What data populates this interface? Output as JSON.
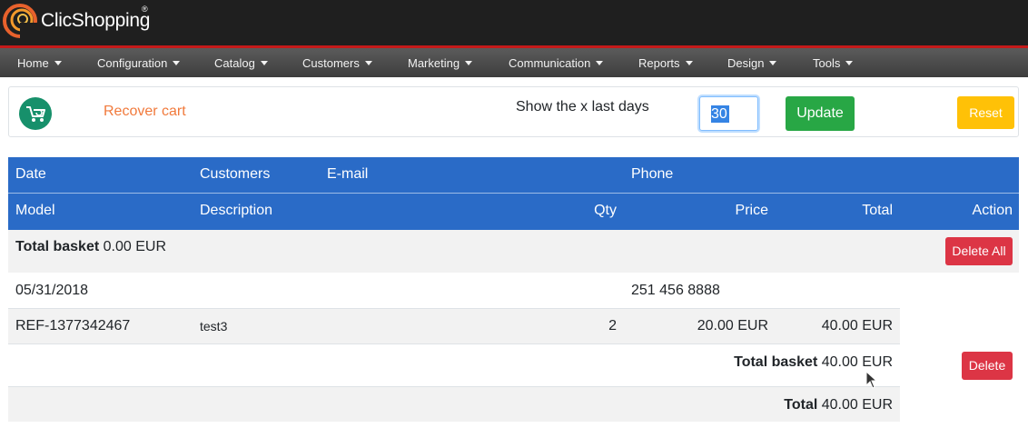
{
  "app": {
    "brand": "ClicShopping",
    "brand_mark": "®"
  },
  "nav": {
    "items": [
      {
        "label": "Home"
      },
      {
        "label": "Configuration"
      },
      {
        "label": "Catalog"
      },
      {
        "label": "Customers"
      },
      {
        "label": "Marketing"
      },
      {
        "label": "Communication"
      },
      {
        "label": "Reports"
      },
      {
        "label": "Design"
      },
      {
        "label": "Tools"
      }
    ]
  },
  "toolbar": {
    "icon": "shopping-cart-refresh-icon",
    "heading": "Recover cart",
    "days_label": "Show the x last days",
    "days_value": "30",
    "update_label": "Update",
    "reset_label": "Reset"
  },
  "table": {
    "header_row1": [
      "Date",
      "Customers",
      "E-mail",
      "Phone"
    ],
    "header_row2": [
      "Model",
      "Description",
      "Qty",
      "Price",
      "Total",
      "Action"
    ],
    "total_basket_row": {
      "label": "Total basket",
      "value": "0.00 EUR",
      "action": "Delete All"
    },
    "cart": {
      "date": "05/31/2018",
      "phone": "251 456 8888",
      "item": {
        "model": "REF-1377342467",
        "description": "test3",
        "qty": "2",
        "price": "20.00 EUR",
        "total": "40.00 EUR"
      },
      "basket_total_label": "Total basket",
      "basket_total_value": "40.00 EUR",
      "delete_label": "Delete"
    },
    "grand_total_label": "Total",
    "grand_total_value": "40.00 EUR"
  },
  "colors": {
    "header_bg": "#1f1f1f",
    "accent_red_line": "#c41a1a",
    "table_header": "#2a6bc7",
    "heading_orange": "#f17a3c",
    "success": "#28a745",
    "warning": "#ffc107",
    "danger": "#dc3545",
    "icon_green": "#17906b"
  }
}
